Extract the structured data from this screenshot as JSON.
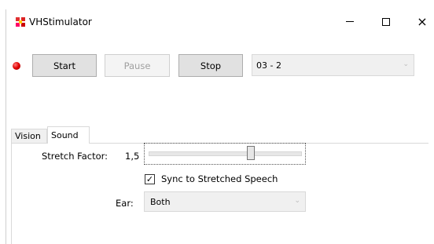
{
  "window": {
    "title": "VHStimulator",
    "minimize_icon": "minimize-icon",
    "maximize_icon": "maximize-icon",
    "close_icon": "close-icon",
    "close_glyph": "×"
  },
  "toolbar": {
    "status_led_color": "#e00000",
    "start_label": "Start",
    "pause_label": "Pause",
    "stop_label": "Stop",
    "selection_value": "03 - 2",
    "dropdown_glyph": "⌄"
  },
  "tabs": [
    {
      "label": "Vision",
      "active": false
    },
    {
      "label": "Sound",
      "active": true
    }
  ],
  "sound": {
    "stretch_label": "Stretch Factor:",
    "stretch_value": "1,5",
    "sync_label": "Sync to Stretched Speech",
    "sync_checked": true,
    "check_glyph": "✓",
    "ear_label": "Ear:",
    "ear_value": "Both"
  }
}
